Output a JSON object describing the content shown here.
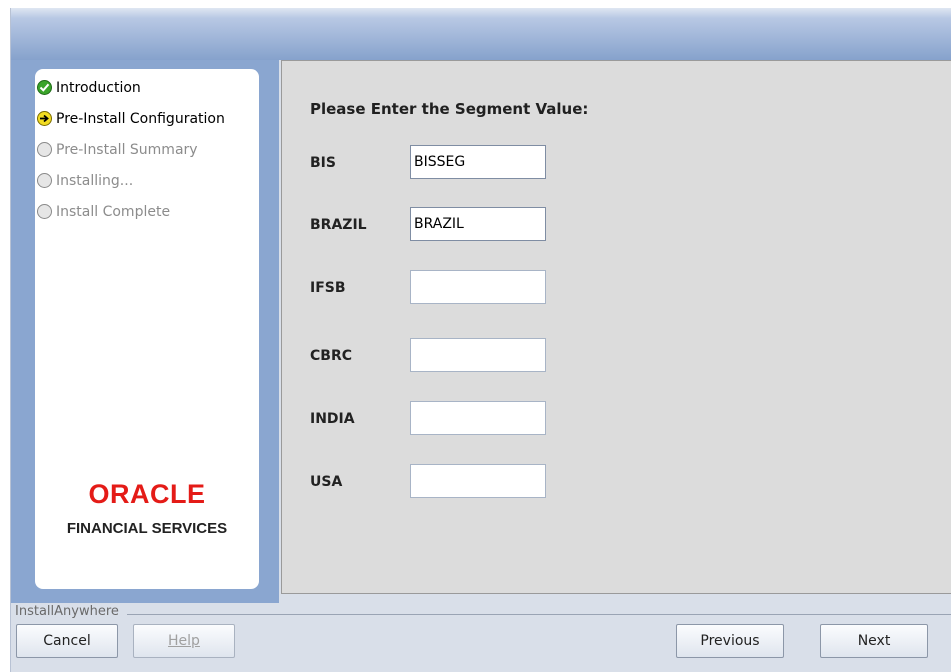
{
  "sidebar": {
    "steps": [
      {
        "label": "Introduction",
        "state": "done",
        "icon": "check-icon"
      },
      {
        "label": "Pre-Install Configuration",
        "state": "active",
        "icon": "arrow-right-icon"
      },
      {
        "label": "Pre-Install Summary",
        "state": "pending",
        "icon": "circle-icon"
      },
      {
        "label": "Installing...",
        "state": "pending",
        "icon": "circle-icon"
      },
      {
        "label": "Install Complete",
        "state": "pending",
        "icon": "circle-icon"
      }
    ],
    "logo": {
      "brand": "ORACLE",
      "subtitle": "FINANCIAL SERVICES"
    }
  },
  "main": {
    "title": "Please Enter the Segment Value:",
    "fields": [
      {
        "label": "BIS",
        "value": "BISSEG"
      },
      {
        "label": "BRAZIL",
        "value": "BRAZIL"
      },
      {
        "label": "IFSB",
        "value": ""
      },
      {
        "label": "CBRC",
        "value": ""
      },
      {
        "label": "INDIA",
        "value": ""
      },
      {
        "label": "USA",
        "value": ""
      }
    ]
  },
  "footer": {
    "vendor_label": "InstallAnywhere",
    "cancel_label": "Cancel",
    "help_label": "Help",
    "previous_label": "Previous",
    "next_label": "Next"
  },
  "colors": {
    "oracle_red": "#e41b17",
    "sidebar_blue": "#8aa6d0",
    "content_bg": "#dcdcdc",
    "check_green": "#3aa42a",
    "arrow_yellow": "#f2dc22"
  }
}
